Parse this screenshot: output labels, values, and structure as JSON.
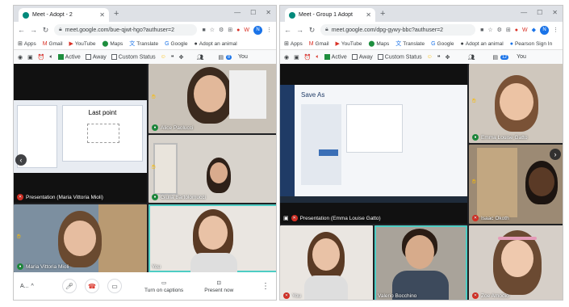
{
  "left_window": {
    "tab_title": "Meet - Adopt - 2",
    "url": "meet.google.com/bue-qjwt-hgo?authuser=2",
    "avatar_letter": "N",
    "bookmarks": [
      "Apps",
      "Gmail",
      "YouTube",
      "Maps",
      "Translate",
      "Google",
      "Adopt an animal"
    ],
    "ext_toolbar": {
      "active": "Active",
      "away": "Away",
      "custom_status": "Custom Status",
      "badge": "8",
      "you": "You"
    },
    "tiles": {
      "presentation_label": "Presentation (Maria Vittoria Mioli)",
      "slide_title": "Last point",
      "alice": "Alice Paolucci",
      "giulia": "Giulia Bartolomucci",
      "maria": "Maria Vittoria Mioli",
      "you": "You"
    },
    "controls": {
      "account_label": "A...",
      "captions": "Turn on captions",
      "present": "Present now"
    }
  },
  "right_window": {
    "tab_title": "Meet - Group 1 Adopt",
    "url": "meet.google.com/dpg-gywy-bbc?authuser=2",
    "avatar_letter": "N",
    "bookmarks": [
      "Apps",
      "Gmail",
      "YouTube",
      "Maps",
      "Translate",
      "Google",
      "Adopt an animal",
      "Pearson Sign In"
    ],
    "ext_toolbar": {
      "active": "Active",
      "away": "Away",
      "custom_status": "Custom Status",
      "badge": "12",
      "you": "You"
    },
    "tiles": {
      "presentation_label": "Presentation (Emma Louise Gatto)",
      "save_as_title": "Save As",
      "emma": "Emma Louise Gatto",
      "isaac": "Isaac Okoth",
      "you": "You",
      "valerio": "Valerio Bocchino",
      "zoe": "Zoe Amodio"
    }
  },
  "colors": {
    "meet_red": "#d93025",
    "meet_green": "#1e8e3e",
    "speaking_outline": "#4ecdc4",
    "hand_yellow": "#fbbc04"
  }
}
